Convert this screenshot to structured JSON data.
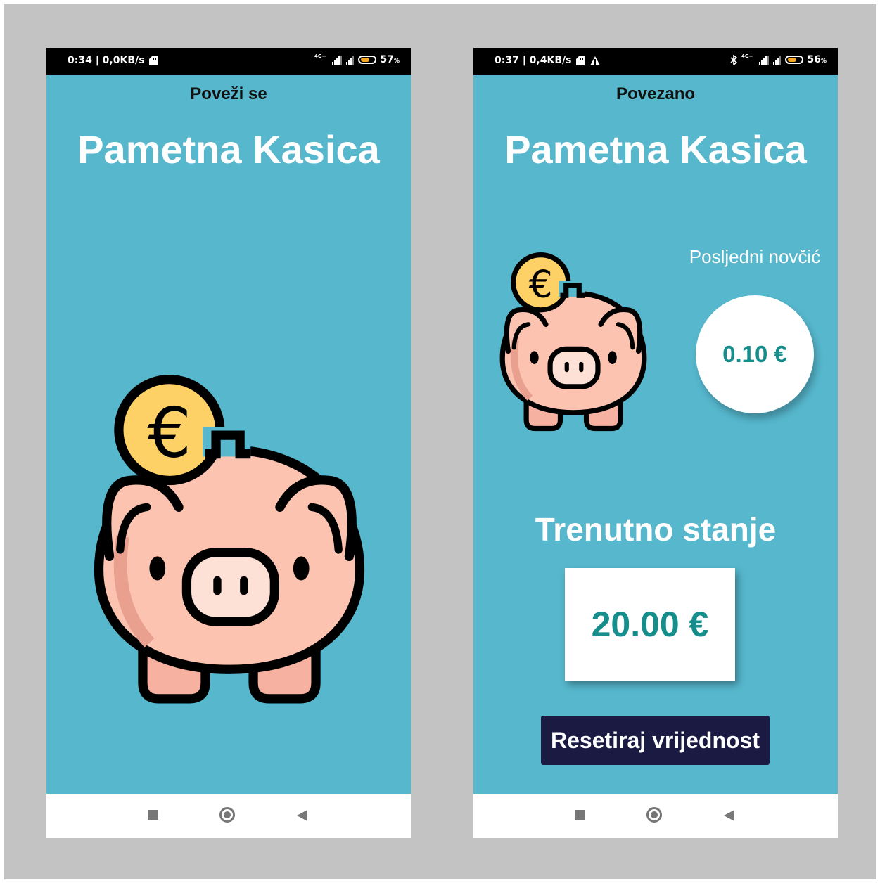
{
  "colors": {
    "app_background": "#56b7cd",
    "frame_background": "#c3c3c3",
    "accent_value": "#168e8c",
    "button_background": "#1a1a42",
    "coin": "#fdd166",
    "pig": "#fcc3b1"
  },
  "screen_left": {
    "status": {
      "time_speed": "0:34 | 0,0KB/s",
      "network": "4G+",
      "battery": "57",
      "battery_unit": "%",
      "battery_level": 0.57
    },
    "connection_label": "Poveži se",
    "title": "Pametna Kasica",
    "nav": [
      "square-icon",
      "home-icon",
      "back-icon"
    ]
  },
  "screen_right": {
    "status": {
      "time_speed": "0:37 | 0,4KB/s",
      "network": "4G+",
      "battery": "56",
      "battery_unit": "%",
      "battery_level": 0.56
    },
    "connection_label": "Povezano",
    "title": "Pametna Kasica",
    "last_coin_label": "Posljedni novčić",
    "last_coin_value": "0.10 €",
    "balance_title": "Trenutno stanje",
    "balance_value": "20.00 €",
    "reset_button": "Resetiraj vrijednost",
    "nav": [
      "square-icon",
      "home-icon",
      "back-icon"
    ]
  },
  "coin_symbol": "€"
}
